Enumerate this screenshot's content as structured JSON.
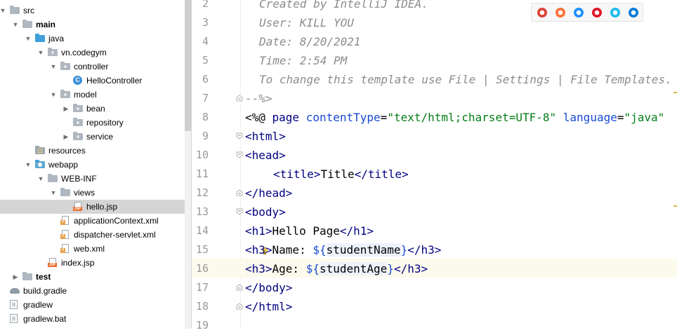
{
  "tree": {
    "items": [
      {
        "label": "src",
        "kind": "folder",
        "depth": 0,
        "expanded": true
      },
      {
        "label": "main",
        "kind": "folder",
        "depth": 1,
        "expanded": true,
        "bold": true
      },
      {
        "label": "java",
        "kind": "folder-blue",
        "depth": 2,
        "expanded": true
      },
      {
        "label": "vn.codegym",
        "kind": "package",
        "depth": 3,
        "expanded": true
      },
      {
        "label": "controller",
        "kind": "package",
        "depth": 4,
        "expanded": true
      },
      {
        "label": "HelloController",
        "kind": "class",
        "depth": 5
      },
      {
        "label": "model",
        "kind": "package",
        "depth": 4,
        "expanded": true
      },
      {
        "label": "bean",
        "kind": "package",
        "depth": 5,
        "expanded": false
      },
      {
        "label": "repository",
        "kind": "package",
        "depth": 5
      },
      {
        "label": "service",
        "kind": "package",
        "depth": 5,
        "expanded": false
      },
      {
        "label": "resources",
        "kind": "resources",
        "depth": 2
      },
      {
        "label": "webapp",
        "kind": "web",
        "depth": 2,
        "expanded": true
      },
      {
        "label": "WEB-INF",
        "kind": "folder",
        "depth": 3,
        "expanded": true
      },
      {
        "label": "views",
        "kind": "folder",
        "depth": 4,
        "expanded": true
      },
      {
        "label": "hello.jsp",
        "kind": "jsp",
        "depth": 5,
        "selected": true
      },
      {
        "label": "applicationContext.xml",
        "kind": "xml",
        "depth": 4
      },
      {
        "label": "dispatcher-servlet.xml",
        "kind": "xml",
        "depth": 4
      },
      {
        "label": "web.xml",
        "kind": "xml",
        "depth": 4
      },
      {
        "label": "index.jsp",
        "kind": "jsp",
        "depth": 3
      },
      {
        "label": "test",
        "kind": "folder",
        "depth": 1,
        "expanded": false,
        "bold": true
      },
      {
        "label": "build.gradle",
        "kind": "gradle",
        "depth": 0
      },
      {
        "label": "gradlew",
        "kind": "file",
        "depth": 0
      },
      {
        "label": "gradlew.bat",
        "kind": "file",
        "depth": 0
      }
    ]
  },
  "editor": {
    "lines": [
      {
        "n": "2",
        "kind": "comment",
        "text": "Created by IntelliJ IDEA."
      },
      {
        "n": "3",
        "kind": "comment",
        "text": "User: KILL YOU"
      },
      {
        "n": "4",
        "kind": "comment",
        "text": "Date: 8/20/2021"
      },
      {
        "n": "5",
        "kind": "comment",
        "text": "Time: 2:54 PM"
      },
      {
        "n": "6",
        "kind": "comment",
        "text": "To change this template use File | Settings | File Templates."
      },
      {
        "n": "7",
        "kind": "comment-end",
        "text": "--%>"
      },
      {
        "n": "8",
        "kind": "directive"
      },
      {
        "n": "9",
        "kind": "tag",
        "text": "<html>"
      },
      {
        "n": "10",
        "kind": "tag",
        "text": "<head>"
      },
      {
        "n": "11",
        "kind": "title"
      },
      {
        "n": "12",
        "kind": "tag",
        "text": "</head>"
      },
      {
        "n": "13",
        "kind": "tag",
        "text": "<body>"
      },
      {
        "n": "14",
        "kind": "h1"
      },
      {
        "n": "15",
        "kind": "h3name"
      },
      {
        "n": "16",
        "kind": "h3age"
      },
      {
        "n": "17",
        "kind": "tag",
        "text": "</body>"
      },
      {
        "n": "18",
        "kind": "tag",
        "text": "</html>"
      },
      {
        "n": "19",
        "kind": "empty",
        "text": ""
      }
    ],
    "directive": {
      "open": "<%@ ",
      "keyword": "page",
      "attr1": "contentType",
      "eq1": "=",
      "val1": "\"text/html;charset=UTF-8\"",
      "attr2": "language",
      "eq2": "=",
      "val2": "\"java\""
    },
    "title_line": {
      "open": "<title>",
      "text": "Title",
      "close": "</title>"
    },
    "h1_line": {
      "open": "<h1>",
      "text": "Hello Page",
      "close": "</h1>"
    },
    "h3name_line": {
      "open": "<h3>",
      "text": "Name: ",
      "expr_open": "${",
      "var": "studentName",
      "expr_close": "}",
      "close": "</h3>"
    },
    "h3age_line": {
      "open": "<h3>",
      "text": "Age: ",
      "expr_open": "${",
      "var": "studentAge",
      "expr_close": "}",
      "close": "</h3>"
    }
  },
  "browsers": [
    {
      "name": "chrome-icon",
      "color": "#db4437"
    },
    {
      "name": "firefox-icon",
      "color": "#ff7139"
    },
    {
      "name": "safari-icon",
      "color": "#1e90ff"
    },
    {
      "name": "opera-icon",
      "color": "#e0162b"
    },
    {
      "name": "ie-icon",
      "color": "#1ebbee"
    },
    {
      "name": "edge-icon",
      "color": "#0c7bd6"
    }
  ],
  "colors": {
    "selection": "#d5d5d5",
    "current_line": "#fcfaed",
    "tag": "#000080",
    "attribute": "#174ad4",
    "string": "#067d17",
    "comment": "#8c8c8c"
  }
}
